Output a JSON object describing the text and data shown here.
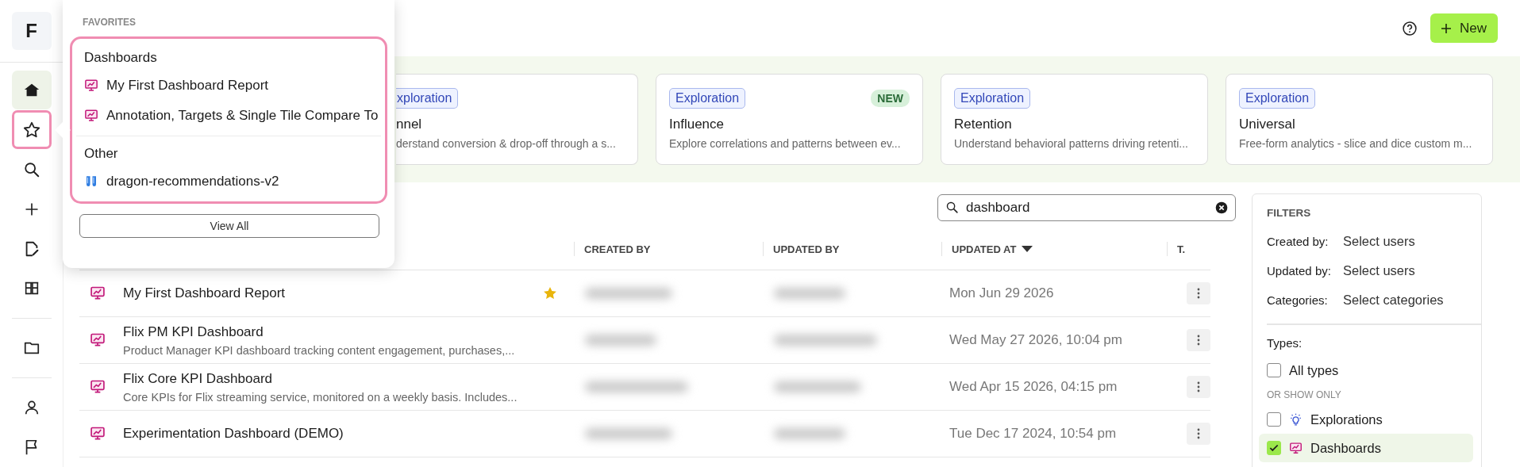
{
  "sidebar": {
    "logo": "F",
    "groups": [
      {
        "items": [
          {
            "kind": "home",
            "selected": true,
            "highlighted": false
          },
          {
            "kind": "star",
            "selected": false,
            "highlighted": true
          },
          {
            "kind": "search",
            "selected": false,
            "highlighted": false
          },
          {
            "kind": "plus",
            "selected": false,
            "highlighted": false
          },
          {
            "kind": "edit",
            "selected": false,
            "highlighted": false
          },
          {
            "kind": "flask",
            "selected": false,
            "highlighted": false
          }
        ]
      },
      {
        "items": [
          {
            "kind": "folder",
            "selected": false,
            "highlighted": false
          }
        ]
      },
      {
        "items": [
          {
            "kind": "person",
            "selected": false,
            "highlighted": false
          },
          {
            "kind": "flag",
            "selected": false,
            "highlighted": false
          }
        ]
      }
    ]
  },
  "header": {
    "new_button": "New"
  },
  "cards": [
    {
      "badge": "xploration",
      "title": "nnel",
      "description": "derstand conversion & drop-off through a s...",
      "new": false,
      "cut": true
    },
    {
      "badge": "Exploration",
      "tag": "NEW",
      "title": "Influence",
      "description": "Explore correlations and patterns between ev...",
      "new": true,
      "cut": false
    },
    {
      "badge": "Exploration",
      "title": "Retention",
      "description": "Understand behavioral patterns driving retenti...",
      "new": false,
      "cut": false
    },
    {
      "badge": "Exploration",
      "title": "Universal",
      "description": "Free-form analytics - slice and dice custom m...",
      "new": false,
      "cut": false
    }
  ],
  "search": {
    "value": "dashboard"
  },
  "table": {
    "columns": [
      {
        "label": "CREATED BY",
        "sorted": false
      },
      {
        "label": "UPDATED BY",
        "sorted": false
      },
      {
        "label": "UPDATED AT",
        "sorted": true
      },
      {
        "label": "T.",
        "sorted": false
      }
    ],
    "rows": [
      {
        "title": "My First Dashboard Report",
        "starred": true,
        "updated_at": "Mon Jun 29 2026"
      },
      {
        "title": "Flix PM KPI Dashboard",
        "description": "Product Manager KPI dashboard tracking content engagement, purchases,...",
        "starred": false,
        "updated_at": "Wed May 27 2026, 10:04 pm"
      },
      {
        "title": "Flix Core KPI Dashboard",
        "description": "Core KPIs for Flix streaming service, monitored on a weekly basis. Includes...",
        "starred": false,
        "updated_at": "Wed Apr 15 2026, 04:15 pm"
      },
      {
        "title": "Experimentation Dashboard (DEMO)",
        "starred": false,
        "updated_at": "Tue Dec 17 2024, 10:54 pm"
      }
    ]
  },
  "filters": {
    "title": "FILTERS",
    "selects": [
      {
        "label": "Created by:",
        "placeholder": "Select users"
      },
      {
        "label": "Updated by:",
        "placeholder": "Select users"
      },
      {
        "label": "Categories:",
        "placeholder": "Select categories"
      }
    ],
    "types_label": "Types:",
    "all_types": {
      "label": "All types",
      "checked": false
    },
    "or_show_only": "OR SHOW ONLY",
    "options": [
      {
        "label": "Explorations",
        "kind": "exploration",
        "checked": false
      },
      {
        "label": "Dashboards",
        "kind": "dashboard",
        "checked": true
      }
    ]
  },
  "popup": {
    "title": "FAVORITES",
    "highlighted": true,
    "sections": [
      {
        "heading": "Dashboards",
        "items": [
          {
            "label": "My First Dashboard Report",
            "kind": "dashboard"
          },
          {
            "label": "Annotation, Targets & Single Tile Compare To",
            "kind": "dashboard"
          }
        ]
      },
      {
        "heading": "Other",
        "items": [
          {
            "label": "dragon-recommendations-v2",
            "kind": "experiment"
          }
        ]
      }
    ],
    "view_all": "View All"
  }
}
